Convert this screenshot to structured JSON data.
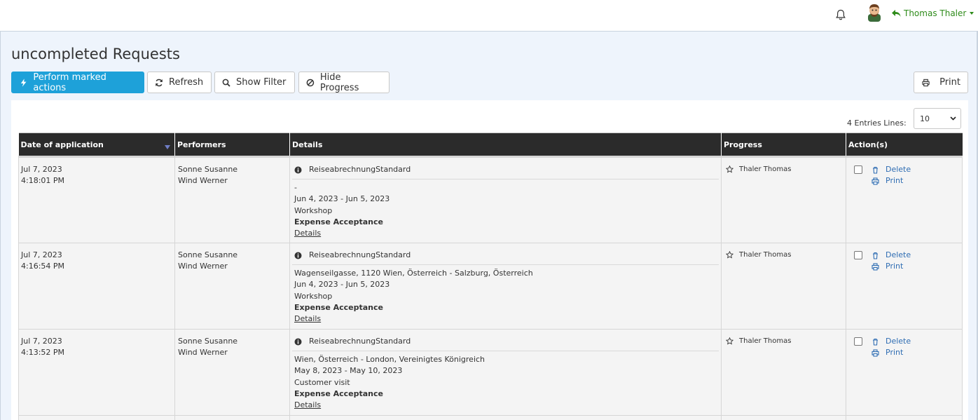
{
  "header": {
    "user_name": "Thomas Thaler",
    "icons": {
      "notifications": "bell-icon",
      "avatar": "avatar",
      "back": "reply-arrow-icon"
    },
    "user_color": "#2e8b1a"
  },
  "page": {
    "title": "uncompleted Requests"
  },
  "toolbar": {
    "perform_label": "Perform marked actions",
    "refresh_label": "Refresh",
    "filter_label": "Show Filter",
    "progress_label": "Hide Progress",
    "print_label": "Print",
    "primary_color": "#1ea1d9"
  },
  "list": {
    "entries_label": "4 Entries Lines:",
    "lines_value": "10",
    "columns": [
      "Date of application",
      "Performers",
      "Details",
      "Progress",
      "Action(s)"
    ],
    "rows": [
      {
        "date": "Jul 7, 2023",
        "time": "4:18:01 PM",
        "performer1": "Sonne Susanne",
        "performer2": "Wind Werner",
        "type": "ReiseabrechnungStandard",
        "route": "-",
        "dates": "Jun 4, 2023 - Jun 5, 2023",
        "purpose": "Workshop",
        "status": "Expense Acceptance",
        "details_link": "Details",
        "progress": "Thaler Thomas",
        "delete": "Delete",
        "print": "Print"
      },
      {
        "date": "Jul 7, 2023",
        "time": "4:16:54 PM",
        "performer1": "Sonne Susanne",
        "performer2": "Wind Werner",
        "type": "ReiseabrechnungStandard",
        "route": "Wagenseilgasse, 1120 Wien, Österreich - Salzburg, Österreich",
        "dates": "Jun 4, 2023 - Jun 5, 2023",
        "purpose": "Workshop",
        "status": "Expense Acceptance",
        "details_link": "Details",
        "progress": "Thaler Thomas",
        "delete": "Delete",
        "print": "Print"
      },
      {
        "date": "Jul 7, 2023",
        "time": "4:13:52 PM",
        "performer1": "Sonne Susanne",
        "performer2": "Wind Werner",
        "type": "ReiseabrechnungStandard",
        "route": "Wien, Österreich - London, Vereinigtes Königreich",
        "dates": "May 8, 2023 - May 10, 2023",
        "purpose": "Customer visit",
        "status": "Expense Acceptance",
        "details_link": "Details",
        "progress": "Thaler Thomas",
        "delete": "Delete",
        "print": "Print"
      }
    ]
  }
}
